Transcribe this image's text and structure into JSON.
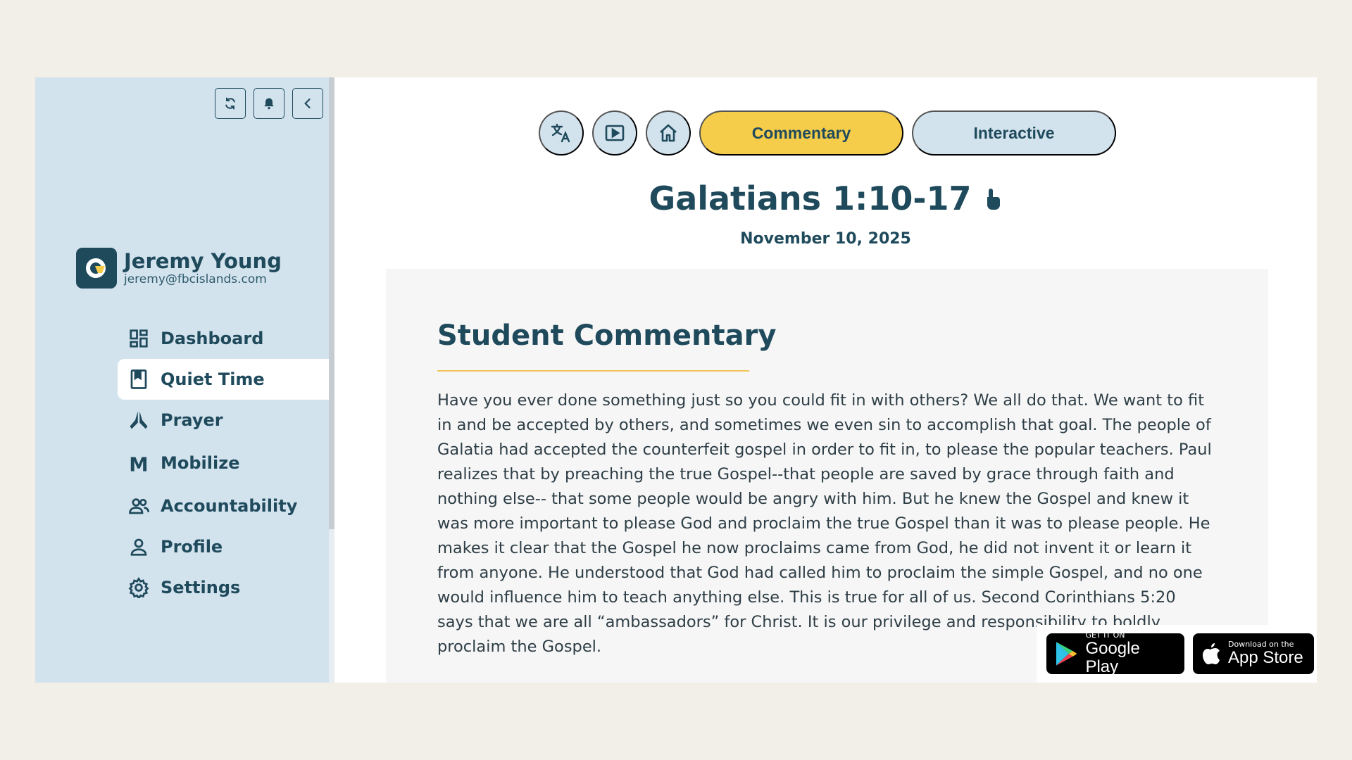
{
  "sidebar": {
    "user": {
      "name": "Jeremy Young",
      "email": "jeremy@fbcislands.com"
    },
    "controls": [
      "refresh-icon",
      "bell-icon",
      "chevron-left-icon"
    ],
    "nav": [
      {
        "label": "Dashboard",
        "icon": "dashboard-icon"
      },
      {
        "label": "Quiet Time",
        "icon": "bookmark-book-icon",
        "active": true
      },
      {
        "label": "Prayer",
        "icon": "praying-hands-icon"
      },
      {
        "label": "Mobilize",
        "icon": "m-letter-icon"
      },
      {
        "label": "Accountability",
        "icon": "people-icon"
      },
      {
        "label": "Profile",
        "icon": "person-icon"
      },
      {
        "label": "Settings",
        "icon": "gear-icon"
      }
    ]
  },
  "toolbar": {
    "icons": [
      "translate-icon",
      "video-play-icon",
      "home-icon"
    ],
    "tabs": [
      {
        "label": "Commentary",
        "active": true
      },
      {
        "label": "Interactive",
        "active": false
      }
    ]
  },
  "passage": {
    "reference": "Galatians 1:10-17",
    "date": "November 10, 2025"
  },
  "commentary": {
    "title": "Student Commentary",
    "body": "Have you ever done something just so you could fit in with others? We all do that. We want to fit in and be accepted by others, and sometimes we even sin to accomplish that goal. The people of Galatia had accepted the counterfeit gospel in order to fit in, to please the popular teachers. Paul realizes that by preaching the true Gospel--that people are saved by grace through faith and nothing else-- that some people would be angry with him. But he knew the Gospel and knew it was more important to please God and proclaim the true Gospel than it was to please people. He makes it clear that the Gospel he now proclaims came from God, he did not invent it or learn it from anyone. He understood that God had called him to proclaim the simple Gospel, and no one would influence him to teach anything else. This is true for all of us. Second Corinthians 5:20 says that we are all “ambassadors” for Christ. It is our privilege and responsibility to boldly proclaim the Gospel."
  },
  "badges": {
    "google": {
      "small": "GET IT ON",
      "big": "Google Play"
    },
    "apple": {
      "small": "Download on the",
      "big": "App Store"
    }
  },
  "colors": {
    "primary": "#1f4a5c",
    "accent": "#f6cd4a",
    "sidebar": "#d3e3ee",
    "background": "#f2eee8"
  }
}
